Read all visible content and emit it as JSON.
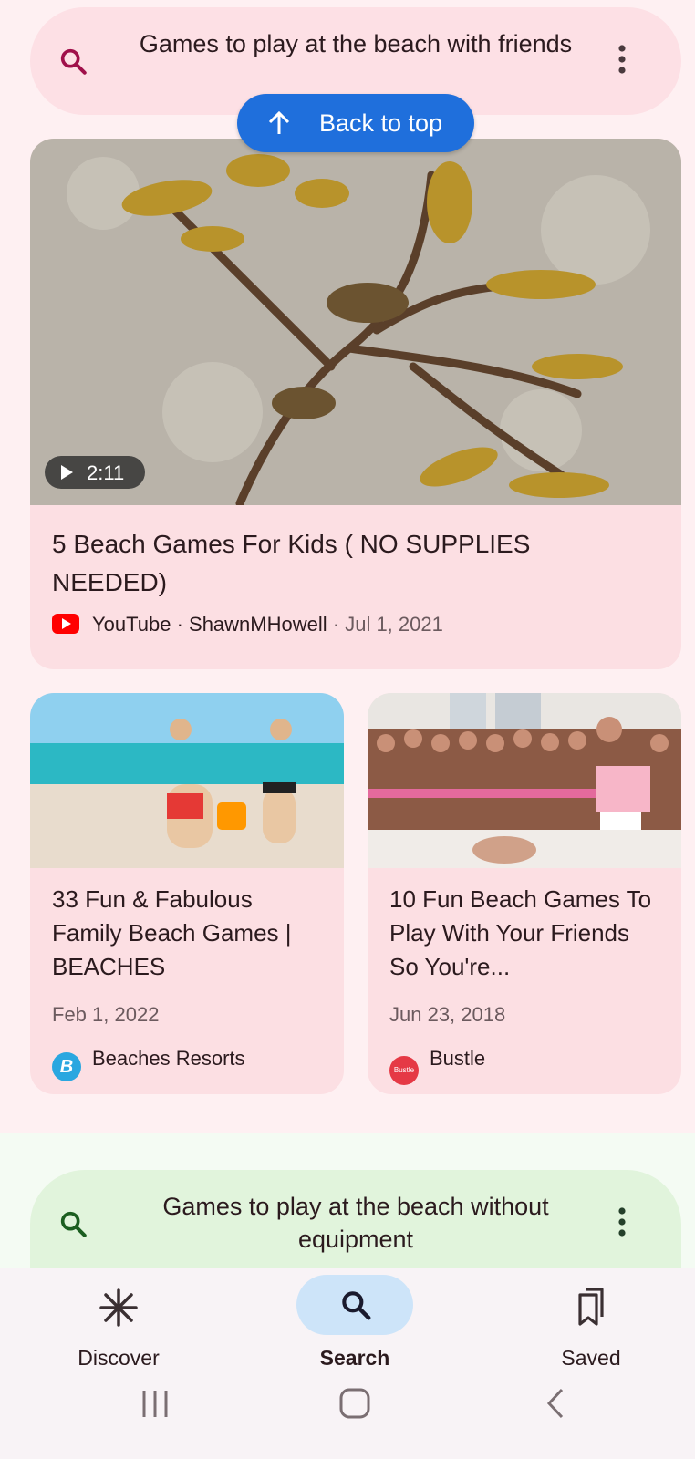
{
  "top_search": {
    "query": "Games to play at the beach with friends"
  },
  "back_to_top": {
    "label": "Back to top"
  },
  "featured": {
    "duration": "2:11",
    "title": "5 Beach Games For Kids ( NO SUPPLIES NEEDED)",
    "source": "YouTube",
    "channel": "ShawnMHowell",
    "date": "Jul 1, 2021"
  },
  "cards": [
    {
      "title": "33 Fun & Fabulous Family Beach Games | BEACHES",
      "date": "Feb 1, 2022",
      "source": "Beaches Resorts",
      "logo_text": "B"
    },
    {
      "title": "10 Fun Beach Games To Play With Your Friends So You're...",
      "date": "Jun 23, 2018",
      "source": "Bustle",
      "logo_text": "Bustle"
    }
  ],
  "next_search": {
    "query": "Games to play at the beach without equipment"
  },
  "bottom_nav": {
    "discover": "Discover",
    "search": "Search",
    "saved": "Saved"
  },
  "colors": {
    "accent_blue": "#1f6fdc",
    "pink_bg": "#fde0e5",
    "green_bg": "#e1f4dc",
    "youtube_red": "#ff0000"
  }
}
